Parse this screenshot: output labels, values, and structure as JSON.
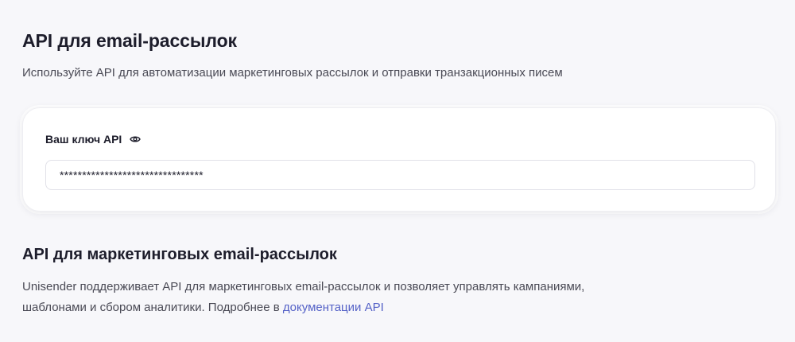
{
  "header": {
    "title": "API для email-рассылок",
    "subtitle": "Используйте API для автоматизации маркетинговых рассылок и отправки транзакционных писем"
  },
  "api_key_card": {
    "label": "Ваш ключ API",
    "toggle_icon": "eye-icon",
    "masked_value": "********************************"
  },
  "marketing_section": {
    "title": "API для маркетинговых email-рассылок",
    "line1": "Unisender поддерживает API для маркетинговых email-рассылок и позволяет управлять кампаниями,",
    "line2_prefix": "шаблонами и сбором аналитики. Подробнее в ",
    "docs_link": "документации API"
  },
  "colors": {
    "background": "#f7f7fa",
    "card": "#ffffff",
    "link": "#5562c7",
    "text": "#1d1d2b"
  }
}
